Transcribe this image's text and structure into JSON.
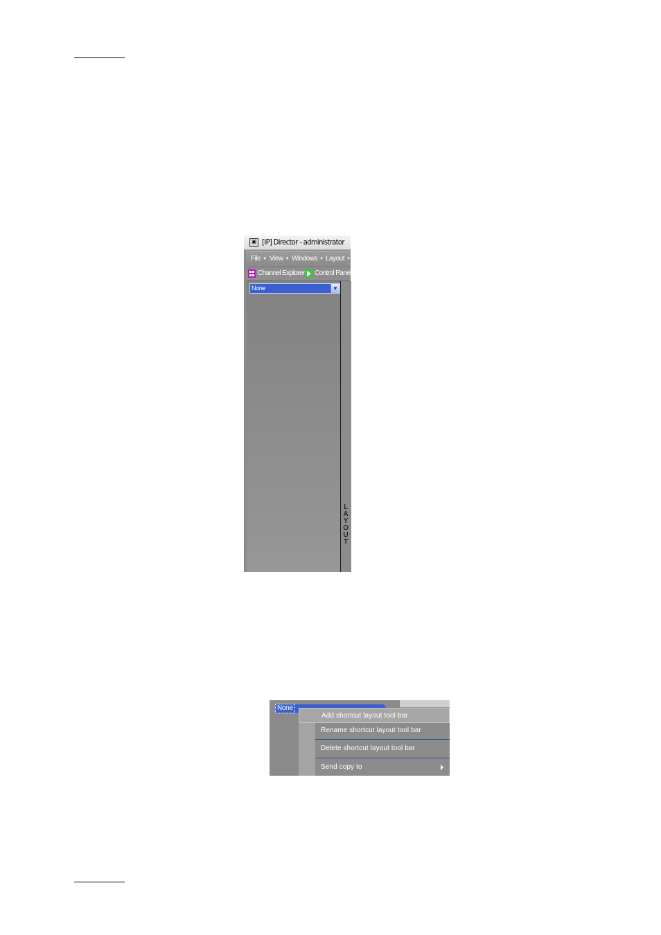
{
  "window": {
    "title": "[IP] Director - administrator",
    "app_icon": "ipd-app-icon"
  },
  "menubar": {
    "items": [
      {
        "label": "File"
      },
      {
        "label": "View"
      },
      {
        "label": "Windows"
      },
      {
        "label": "Layout"
      }
    ],
    "dropdown_glyph": "▾"
  },
  "shortcuts": {
    "items": [
      {
        "label": "Channel Explorer",
        "icon": "channel-explorer-icon",
        "color": "#b21fb8"
      },
      {
        "label": "Control Panel",
        "icon": "control-panel-icon",
        "color": "#3cc83c"
      }
    ]
  },
  "layout_panel": {
    "selected": "None",
    "vertical_tab": "LAYOUT",
    "selection_color": "#3a5fd0"
  },
  "context_menu_shot": {
    "selected": "None",
    "items": [
      {
        "label": "Add shortcut layout tool bar",
        "highlighted": true
      },
      {
        "label": "Rename shortcut layout tool bar"
      },
      {
        "label": "Delete shortcut layout tool bar"
      },
      {
        "label": "Send copy to",
        "has_submenu": true
      }
    ]
  }
}
